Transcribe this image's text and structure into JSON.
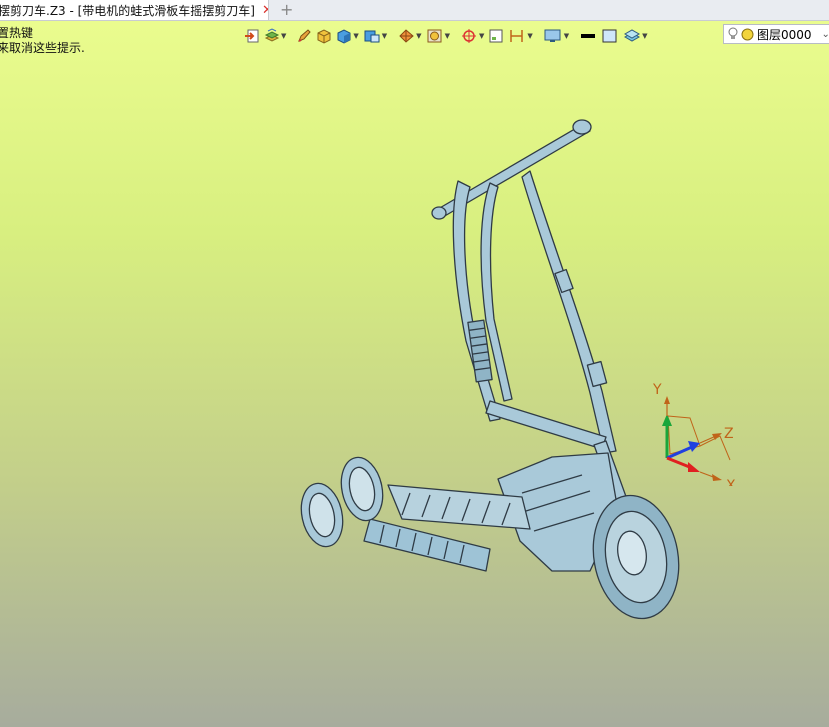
{
  "tab": {
    "title": "摆剪刀车.Z3 - [带电机的蛙式滑板车摇摆剪刀车]",
    "close_glyph": "✕",
    "new_tab_glyph": "+"
  },
  "hints": {
    "line1": "置热键",
    "line2": "来取消这些提示."
  },
  "toolbar": {
    "icons": [
      "import-icon",
      "layers-icon",
      "pen-icon",
      "box-icon",
      "shaded-cube-icon",
      "view-cube-icon",
      "render-icon",
      "frame-icon",
      "target-icon",
      "window-icon",
      "dimension-icon",
      "display-icon",
      "line-color-icon",
      "fill-color-icon",
      "layer-stack-icon"
    ],
    "layer_value": "图层0000"
  },
  "triad": {
    "x_label": "X",
    "y_label": "Y",
    "z_label": "Z"
  },
  "colors": {
    "bg_top": "#eafc8e",
    "bg_bottom": "#a7ac9d",
    "model_stroke": "#2f3b45",
    "model_fill": "#9ec3d6"
  }
}
